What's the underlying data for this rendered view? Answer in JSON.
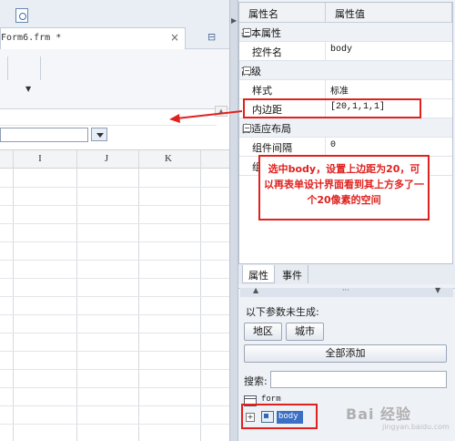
{
  "document_tab": {
    "title": "Form6.frm *",
    "close": "×"
  },
  "grid": {
    "columns": [
      "I",
      "J",
      "K"
    ]
  },
  "properties": {
    "headers": {
      "name": "属性名",
      "value": "属性值"
    },
    "rows": [
      {
        "kind": "category",
        "label": "基本属性",
        "toggle": "⊟"
      },
      {
        "kind": "prop",
        "name": "控件名",
        "value": "body"
      },
      {
        "kind": "category",
        "label": "高级",
        "toggle": "⊟"
      },
      {
        "kind": "prop",
        "name": "样式",
        "value": "标准"
      },
      {
        "kind": "prop",
        "name": "内边距",
        "value": "[20,1,1,1]"
      },
      {
        "kind": "category",
        "label": "自适应布局",
        "toggle": "⊟"
      },
      {
        "kind": "prop",
        "name": "组件间隔",
        "value": "0"
      },
      {
        "kind": "prop",
        "name": "组",
        "value": ""
      }
    ]
  },
  "tabs": {
    "props": "属性",
    "events": "事件"
  },
  "lower": {
    "ungenerated_label": "以下参数未生成:",
    "btn_region": "地区",
    "btn_city": "城市",
    "btn_add_all": "全部添加",
    "search_label": "搜索:",
    "search_value": "",
    "tree": {
      "form": "form",
      "body": "body",
      "expand": "+"
    }
  },
  "annotation": {
    "callout": "选中body，设置上边距为20，可以再表单设计界面看到其上方多了一个20像素的空间"
  },
  "watermark": {
    "logo": "Bai 经验",
    "url": "jingyan.baidu.com"
  },
  "colors": {
    "highlight": "#e0211e",
    "selection": "#3b6fc4"
  }
}
